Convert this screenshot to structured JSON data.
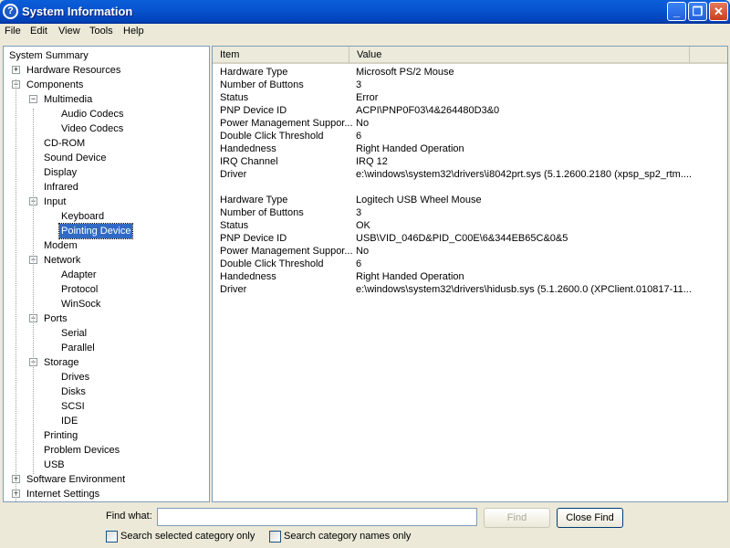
{
  "window": {
    "title": "System Information",
    "icon": "?"
  },
  "menu": [
    {
      "label": "File"
    },
    {
      "label": "Edit"
    },
    {
      "label": "View"
    },
    {
      "label": "Tools"
    },
    {
      "label": "Help"
    }
  ],
  "tree": [
    {
      "label": "System Summary",
      "level": 0,
      "exp": ""
    },
    {
      "label": "Hardware Resources",
      "level": 1,
      "exp": "+"
    },
    {
      "label": "Components",
      "level": 1,
      "exp": "-"
    },
    {
      "label": "Multimedia",
      "level": 2,
      "exp": "-"
    },
    {
      "label": "Audio Codecs",
      "level": 3,
      "exp": ""
    },
    {
      "label": "Video Codecs",
      "level": 3,
      "exp": ""
    },
    {
      "label": "CD-ROM",
      "level": 2,
      "exp": ""
    },
    {
      "label": "Sound Device",
      "level": 2,
      "exp": ""
    },
    {
      "label": "Display",
      "level": 2,
      "exp": ""
    },
    {
      "label": "Infrared",
      "level": 2,
      "exp": ""
    },
    {
      "label": "Input",
      "level": 2,
      "exp": "-"
    },
    {
      "label": "Keyboard",
      "level": 3,
      "exp": ""
    },
    {
      "label": "Pointing Device",
      "level": 3,
      "exp": "",
      "selected": true
    },
    {
      "label": "Modem",
      "level": 2,
      "exp": ""
    },
    {
      "label": "Network",
      "level": 2,
      "exp": "-"
    },
    {
      "label": "Adapter",
      "level": 3,
      "exp": ""
    },
    {
      "label": "Protocol",
      "level": 3,
      "exp": ""
    },
    {
      "label": "WinSock",
      "level": 3,
      "exp": ""
    },
    {
      "label": "Ports",
      "level": 2,
      "exp": "-"
    },
    {
      "label": "Serial",
      "level": 3,
      "exp": ""
    },
    {
      "label": "Parallel",
      "level": 3,
      "exp": ""
    },
    {
      "label": "Storage",
      "level": 2,
      "exp": "-"
    },
    {
      "label": "Drives",
      "level": 3,
      "exp": ""
    },
    {
      "label": "Disks",
      "level": 3,
      "exp": ""
    },
    {
      "label": "SCSI",
      "level": 3,
      "exp": ""
    },
    {
      "label": "IDE",
      "level": 3,
      "exp": ""
    },
    {
      "label": "Printing",
      "level": 2,
      "exp": ""
    },
    {
      "label": "Problem Devices",
      "level": 2,
      "exp": ""
    },
    {
      "label": "USB",
      "level": 2,
      "exp": ""
    },
    {
      "label": "Software Environment",
      "level": 1,
      "exp": "+"
    },
    {
      "label": "Internet Settings",
      "level": 1,
      "exp": "+"
    }
  ],
  "list": {
    "headers": [
      "Item",
      "Value"
    ],
    "rows": [
      [
        "Hardware Type",
        "Microsoft PS/2 Mouse"
      ],
      [
        "Number of Buttons",
        "3"
      ],
      [
        "Status",
        "Error"
      ],
      [
        "PNP Device ID",
        "ACPI\\PNP0F03\\4&264480D3&0"
      ],
      [
        "Power Management Suppor...",
        "No"
      ],
      [
        "Double Click Threshold",
        "6"
      ],
      [
        "Handedness",
        "Right Handed Operation"
      ],
      [
        "IRQ Channel",
        "IRQ 12"
      ],
      [
        "Driver",
        "e:\\windows\\system32\\drivers\\i8042prt.sys (5.1.2600.2180 (xpsp_sp2_rtm...."
      ],
      [
        "",
        ""
      ],
      [
        "Hardware Type",
        "Logitech USB Wheel Mouse"
      ],
      [
        "Number of Buttons",
        "3"
      ],
      [
        "Status",
        "OK"
      ],
      [
        "PNP Device ID",
        "USB\\VID_046D&PID_C00E\\6&344EB65C&0&5"
      ],
      [
        "Power Management Suppor...",
        "No"
      ],
      [
        "Double Click Threshold",
        "6"
      ],
      [
        "Handedness",
        "Right Handed Operation"
      ],
      [
        "Driver",
        "e:\\windows\\system32\\drivers\\hidusb.sys (5.1.2600.0 (XPClient.010817-11..."
      ]
    ]
  },
  "find": {
    "label": "Find what:",
    "value": "",
    "find_button": "Find",
    "close_button": "Close Find",
    "check1": "Search selected category only",
    "check2": "Search category names only"
  }
}
